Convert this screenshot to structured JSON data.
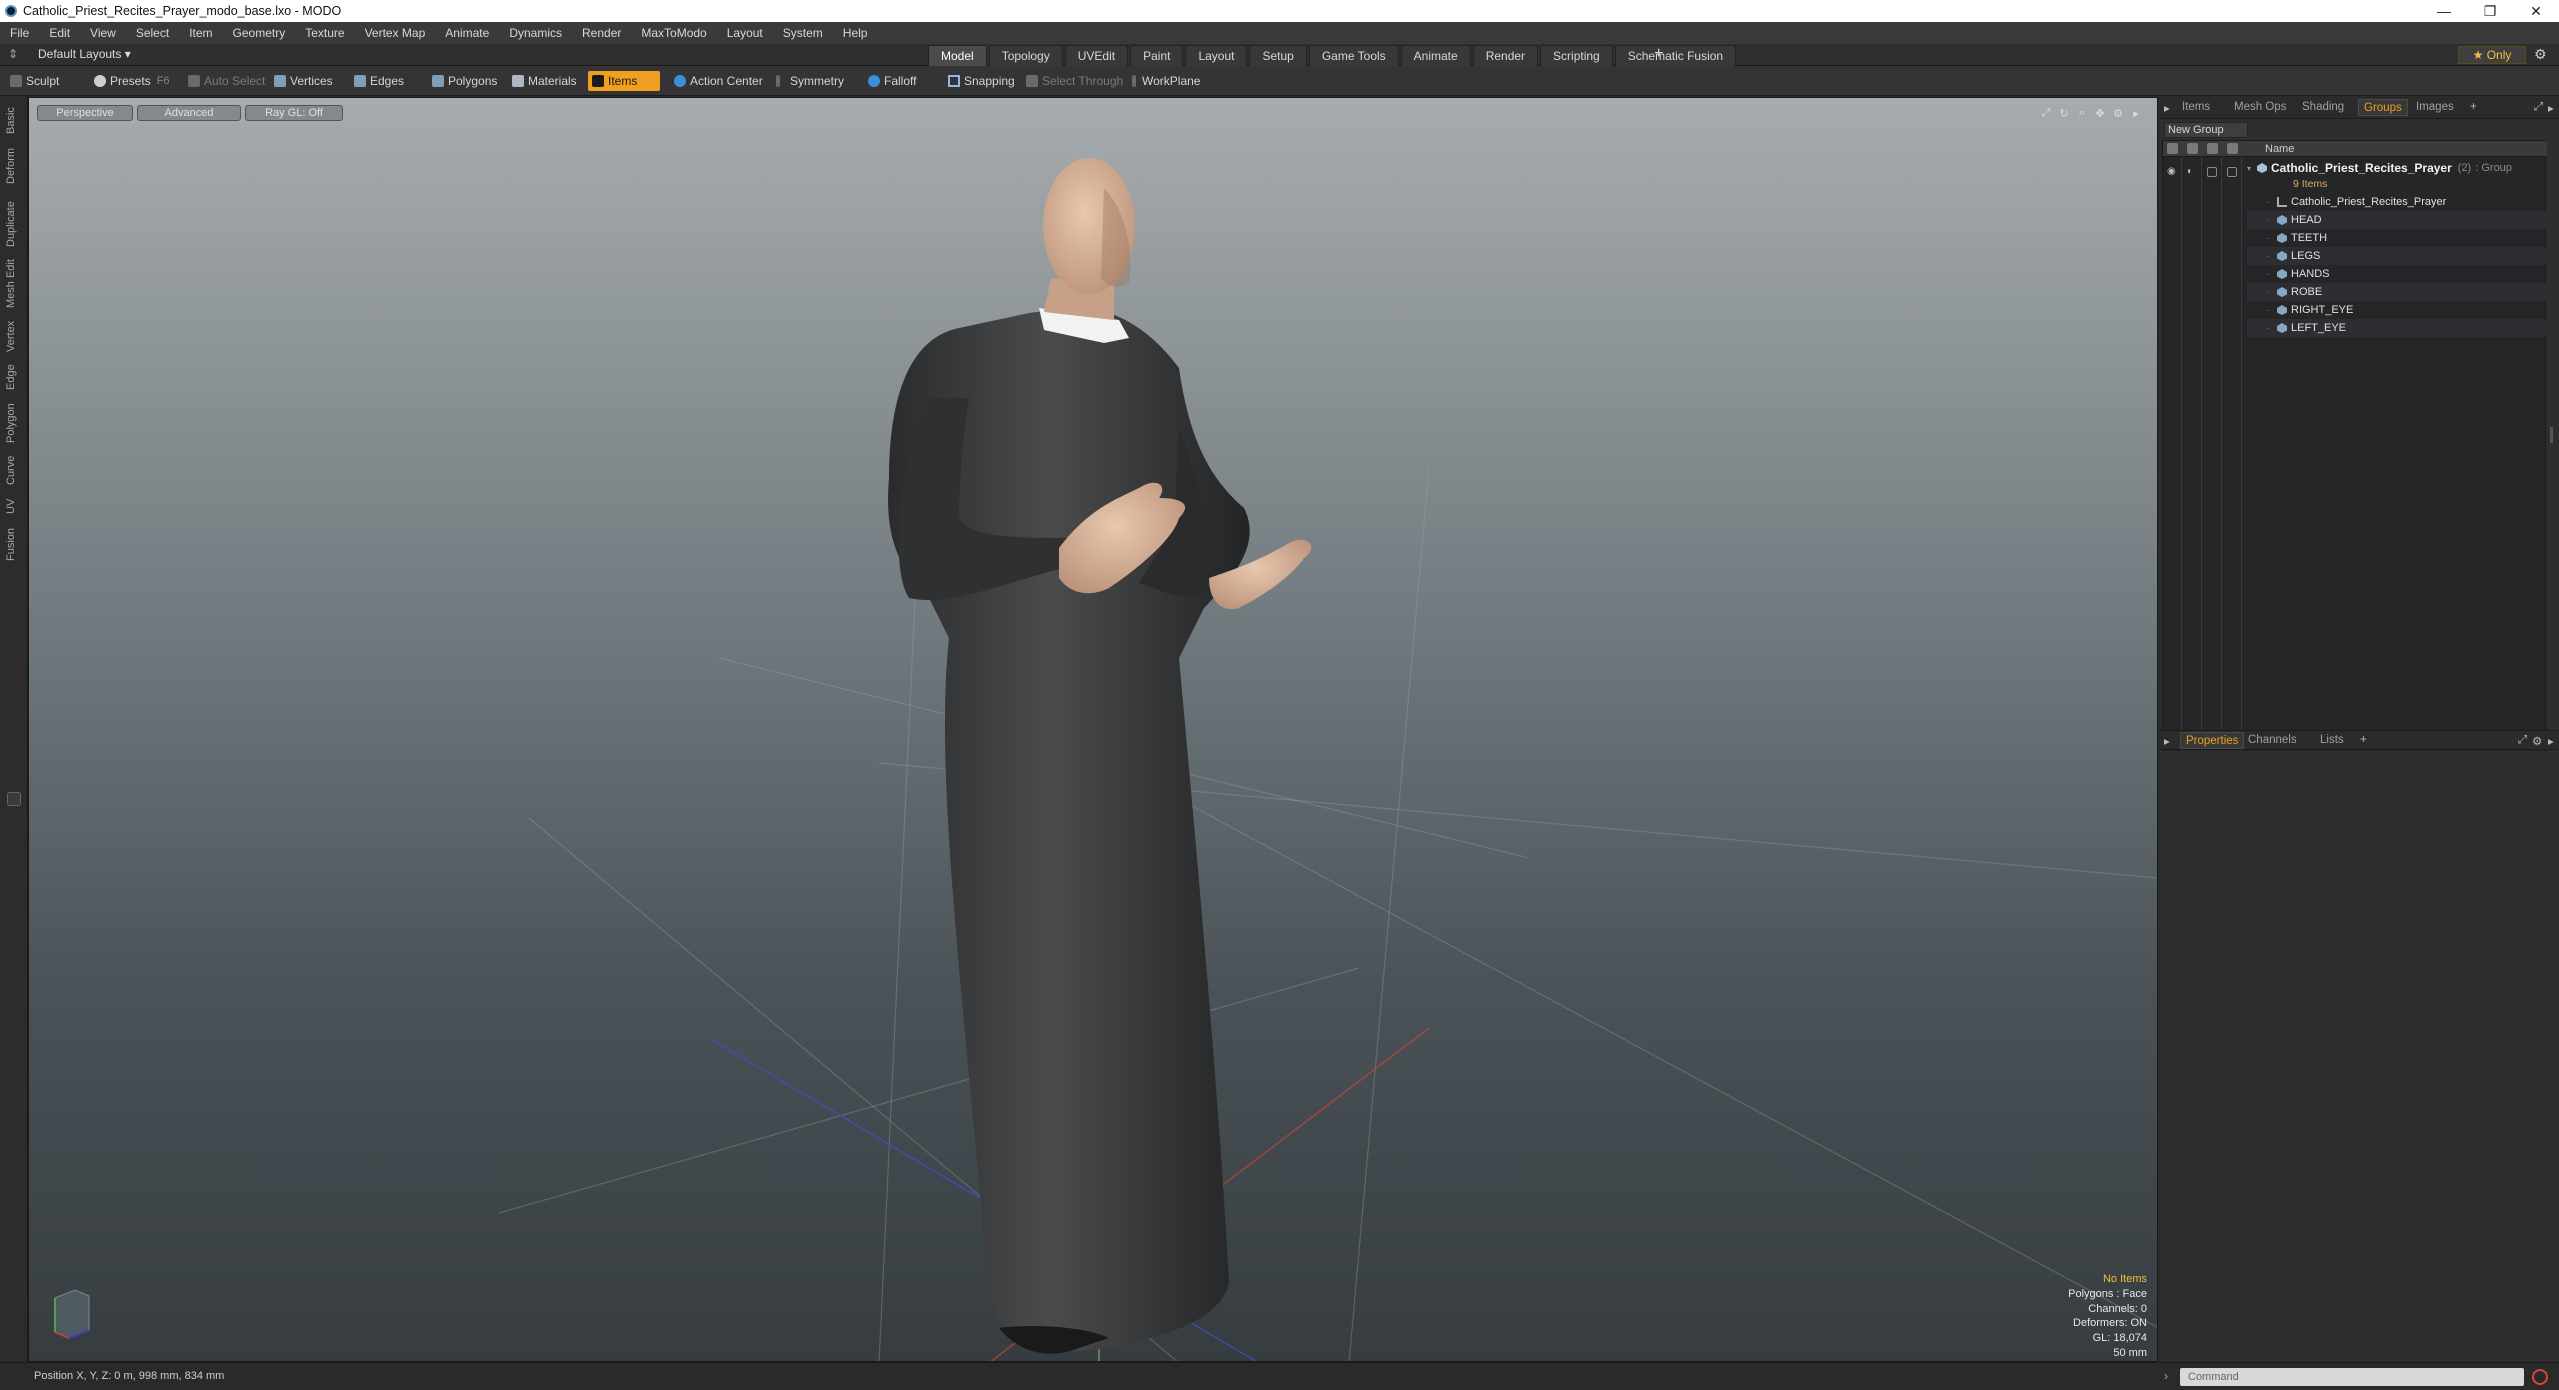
{
  "window": {
    "title": "Catholic_Priest_Recites_Prayer_modo_base.lxo - MODO",
    "controls": [
      "—",
      "❐",
      "✕"
    ]
  },
  "menu": [
    "File",
    "Edit",
    "View",
    "Select",
    "Item",
    "Geometry",
    "Texture",
    "Vertex Map",
    "Animate",
    "Dynamics",
    "Render",
    "MaxToModo",
    "Layout",
    "System",
    "Help"
  ],
  "layoutbar": {
    "layout_label": "Default Layouts ▾",
    "tabs": [
      "Model",
      "Topology",
      "UVEdit",
      "Paint",
      "Layout",
      "Setup",
      "Game Tools",
      "Animate",
      "Render",
      "Scripting",
      "Schematic Fusion"
    ],
    "active_tab": "Model",
    "plus": "+",
    "only_label": "★  Only"
  },
  "toolbar": {
    "sculpt": "Sculpt",
    "presets": "Presets",
    "presets_key": "F6",
    "auto_select": "Auto Select",
    "vertices": "Vertices",
    "edges": "Edges",
    "polygons": "Polygons",
    "materials": "Materials",
    "items": "Items",
    "action_center": "Action Center",
    "symmetry": "Symmetry",
    "falloff": "Falloff",
    "snapping": "Snapping",
    "select_through": "Select Through",
    "workplane": "WorkPlane"
  },
  "left_tabs": [
    "Basic",
    "Deform",
    "Duplicate",
    "Mesh Edit",
    "Vertex",
    "Edge",
    "Polygon",
    "Curve",
    "UV",
    "Fusion"
  ],
  "viewport": {
    "tabs": [
      "Perspective",
      "Advanced",
      "Ray GL: Off"
    ],
    "info": {
      "selection": "No Items",
      "polygons": "Polygons : Face",
      "channels": "Channels: 0",
      "deformers": "Deformers: ON",
      "gl": "GL: 18,074",
      "scale": "50 mm"
    }
  },
  "status": {
    "position": "Position X, Y, Z:   0 m, 998 mm, 834 mm",
    "command_placeholder": "Command"
  },
  "right_panel": {
    "tabs": [
      "Items",
      "Mesh Ops",
      "Shading",
      "Groups",
      "Images"
    ],
    "active_tab": "Groups",
    "new_group": "New Group",
    "name_header": "Name",
    "group": {
      "name": "Catholic_Priest_Recites_Prayer",
      "count": "(2)",
      "kind": ": Group",
      "sub": "9 Items"
    },
    "items": [
      {
        "name": "Catholic_Priest_Recites_Prayer",
        "type": "locator"
      },
      {
        "name": "HEAD",
        "type": "mesh"
      },
      {
        "name": "TEETH",
        "type": "mesh"
      },
      {
        "name": "LEGS",
        "type": "mesh"
      },
      {
        "name": "HANDS",
        "type": "mesh"
      },
      {
        "name": "ROBE",
        "type": "mesh"
      },
      {
        "name": "RIGHT_EYE",
        "type": "mesh"
      },
      {
        "name": "LEFT_EYE",
        "type": "mesh"
      }
    ],
    "props_tabs": [
      "Properties",
      "Channels",
      "Lists"
    ],
    "props_active": "Properties"
  }
}
